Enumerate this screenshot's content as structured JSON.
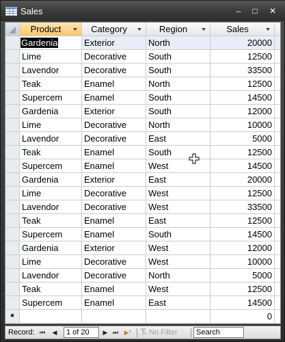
{
  "window": {
    "title": "Sales",
    "minimize_glyph": "–",
    "maximize_glyph": "□",
    "close_glyph": "✕"
  },
  "columns": [
    "Product",
    "Category",
    "Region",
    "Sales"
  ],
  "rows": [
    [
      "Gardenia",
      "Exterior",
      "North",
      "20000"
    ],
    [
      "Lime",
      "Decorative",
      "South",
      "12500"
    ],
    [
      "Lavendor",
      "Decorative",
      "South",
      "33500"
    ],
    [
      "Teak",
      "Enamel",
      "North",
      "12500"
    ],
    [
      "Supercem",
      "Enamel",
      "South",
      "14500"
    ],
    [
      "Gardenia",
      "Exterior",
      "South",
      "12000"
    ],
    [
      "Lime",
      "Decorative",
      "North",
      "10000"
    ],
    [
      "Lavendor",
      "Decorative",
      "East",
      "5000"
    ],
    [
      "Teak",
      "Enamel",
      "South",
      "12500"
    ],
    [
      "Supercem",
      "Enamel",
      "West",
      "14500"
    ],
    [
      "Gardenia",
      "Exterior",
      "East",
      "20000"
    ],
    [
      "Lime",
      "Decorative",
      "West",
      "12500"
    ],
    [
      "Lavendor",
      "Decorative",
      "West",
      "33500"
    ],
    [
      "Teak",
      "Enamel",
      "East",
      "12500"
    ],
    [
      "Supercem",
      "Enamel",
      "South",
      "14500"
    ],
    [
      "Gardenia",
      "Exterior",
      "West",
      "12000"
    ],
    [
      "Lime",
      "Decorative",
      "West",
      "10000"
    ],
    [
      "Lavendor",
      "Decorative",
      "North",
      "5000"
    ],
    [
      "Teak",
      "Enamel",
      "West",
      "12500"
    ],
    [
      "Supercem",
      "Enamel",
      "East",
      "14500"
    ]
  ],
  "new_row": {
    "marker": "*",
    "sales_default": "0"
  },
  "navigation": {
    "label": "Record:",
    "first_glyph": "⏮",
    "prev_glyph": "◀",
    "next_glyph": "▶",
    "last_glyph": "⏭",
    "new_glyph": "▶*",
    "position": "1 of 20",
    "filter_label": "No Filter",
    "search_placeholder": "Search"
  },
  "colors": {
    "header_active": "#f8c56c",
    "selection_bg": "#000000",
    "current_row_bg": "#e9edf7"
  }
}
